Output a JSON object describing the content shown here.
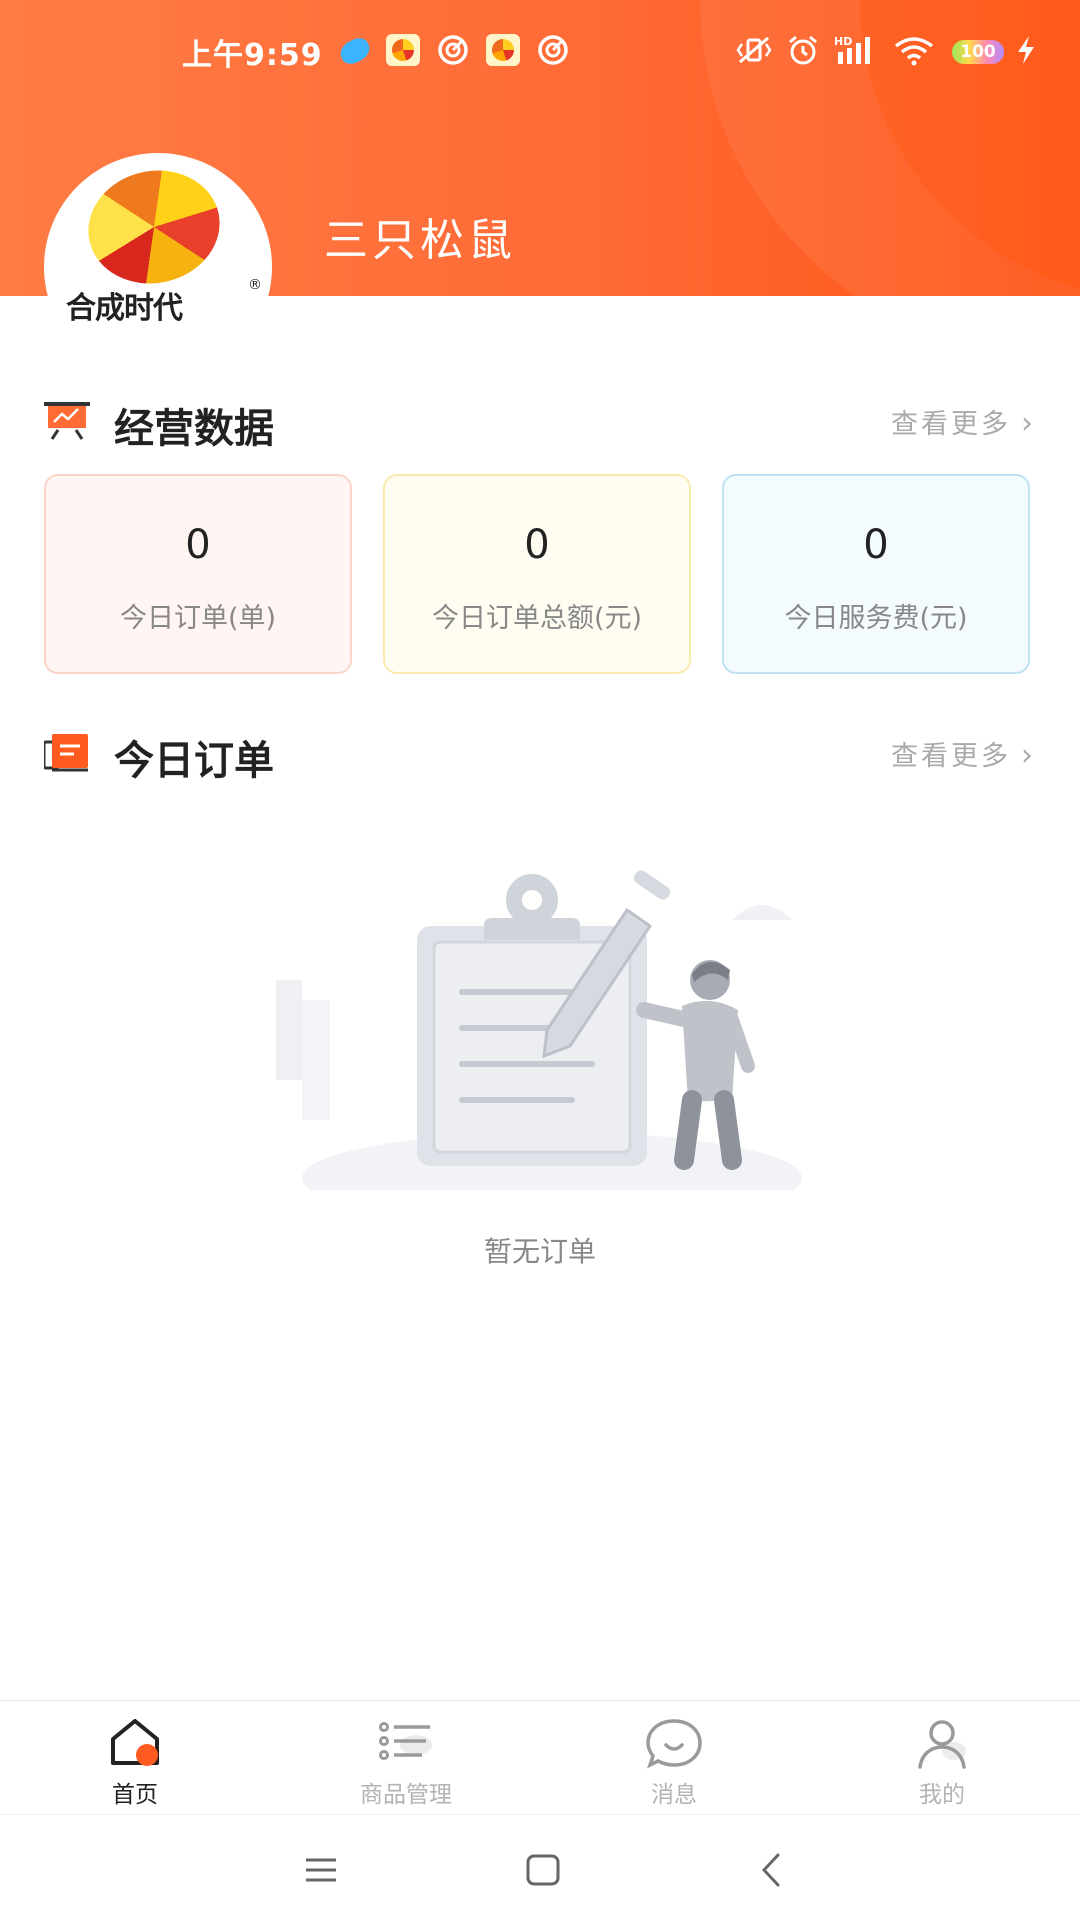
{
  "status_bar": {
    "time": "上午9:59",
    "battery": "100",
    "network": "HD"
  },
  "header": {
    "logo_text": "合成时代",
    "logo_reg": "®",
    "shop_name": "三只松鼠"
  },
  "business_data": {
    "title": "经营数据",
    "more_label": "查看更多",
    "cards": [
      {
        "value": "0",
        "label": "今日订单(单)"
      },
      {
        "value": "0",
        "label": "今日订单总额(元)"
      },
      {
        "value": "0",
        "label": "今日服务费(元)"
      }
    ]
  },
  "today_orders": {
    "title": "今日订单",
    "more_label": "查看更多",
    "empty_text": "暂无订单"
  },
  "tabbar": {
    "items": [
      {
        "label": "首页",
        "icon": "home-icon",
        "active": true
      },
      {
        "label": "商品管理",
        "icon": "list-icon",
        "active": false
      },
      {
        "label": "消息",
        "icon": "chat-icon",
        "active": false
      },
      {
        "label": "我的",
        "icon": "user-icon",
        "active": false
      }
    ]
  },
  "colors": {
    "brand": "#ff6a35",
    "text": "#222222",
    "muted": "#888888"
  }
}
